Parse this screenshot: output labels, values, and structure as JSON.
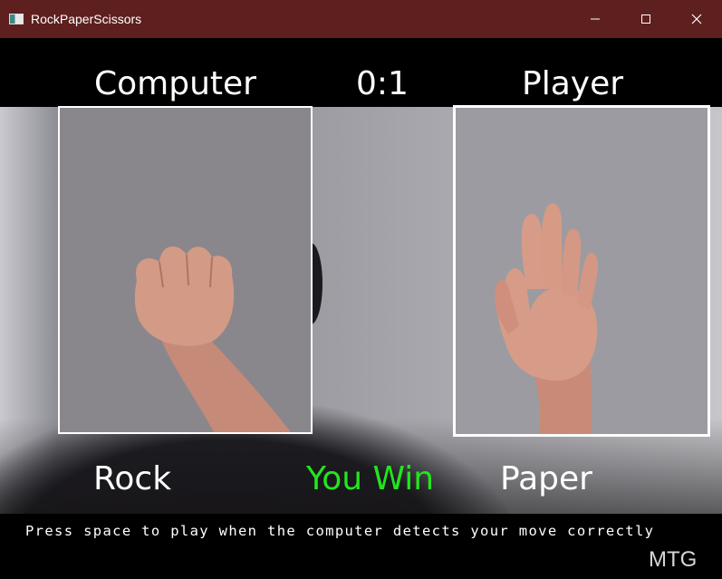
{
  "window": {
    "title": "RockPaperScissors"
  },
  "header": {
    "computer_label": "Computer",
    "score": "0:1",
    "player_label": "Player"
  },
  "round": {
    "computer_move": "Rock",
    "result": "You Win",
    "player_move": "Paper"
  },
  "footer": {
    "instructions": "Press space to play when the computer detects your move correctly",
    "brand": "MTG"
  },
  "colors": {
    "title_bar": "#5e1f1f",
    "result_text": "#22e61f",
    "box_border": "#ffffff"
  },
  "icons": {
    "app": "app-window-icon",
    "minimize": "minimize-icon",
    "maximize": "maximize-icon",
    "close": "close-icon"
  }
}
